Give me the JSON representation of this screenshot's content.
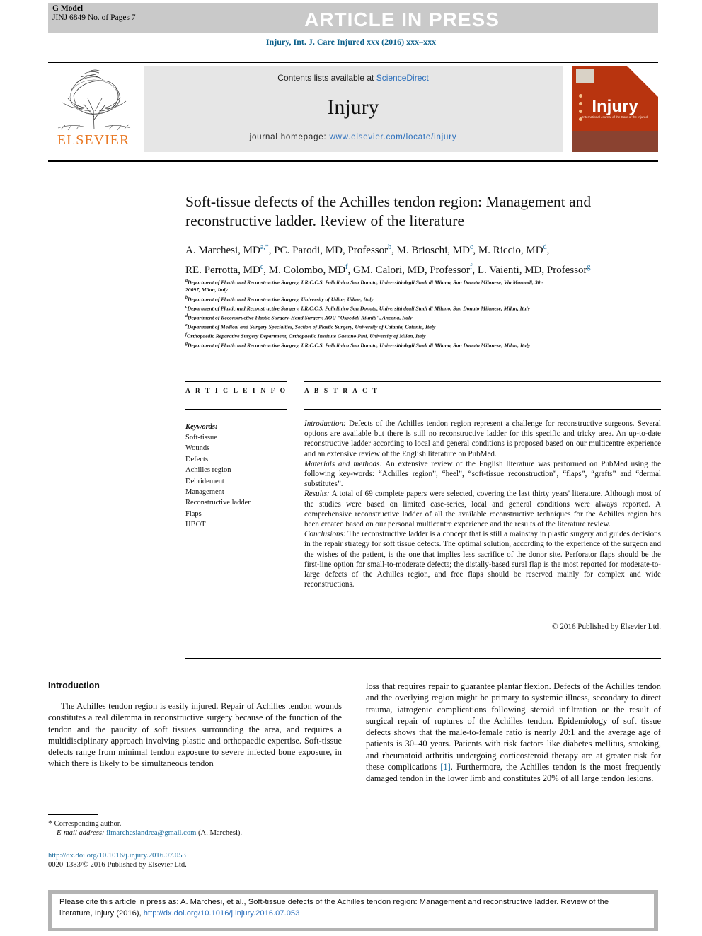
{
  "header": {
    "g_model_line1": "G Model",
    "g_model_line2": "JINJ 6849 No. of Pages 7",
    "article_in_press": "ARTICLE IN PRESS",
    "journal_ref": "Injury, Int. J. Care Injured xxx (2016) xxx–xxx"
  },
  "masthead": {
    "contents_prefix": "Contents lists available at ",
    "contents_link": "ScienceDirect",
    "journal_name": "Injury",
    "homepage_prefix": "journal homepage: ",
    "homepage_link": "www.elsevier.com/locate/injury",
    "publisher": "ELSEVIER",
    "cover_title": "Injury",
    "cover_sub": "International Journal of the Care of the Injured"
  },
  "article": {
    "title": "Soft-tissue defects of the Achilles tendon region: Management and reconstructive ladder. Review of the literature",
    "authors_line1": "A. Marchesi, MD",
    "authors_line2": "RE. Perrotta, MD",
    "authors_html_1": "A. Marchesi, MD<sup>a,*</sup>, PC. Parodi, MD, Professor<sup>b</sup>, M. Brioschi, MD<sup>c</sup>, M. Riccio, MD<sup>d</sup>,",
    "authors_html_2": "RE. Perrotta, MD<sup>e</sup>, M. Colombo, MD<sup>f</sup>, GM. Calori, MD, Professor<sup>f</sup>, L. Vaienti, MD, Professor<sup>g</sup>",
    "affiliations": [
      "a Department of Plastic and Reconstructive Surgery, I.R.C.C.S. Policlinico San Donato, Università degli Studi di Milano, San Donato Milanese, Via Morandi, 30 -",
      "20097, Milan, Italy",
      "b Department of Plastic and Reconstructive Surgery, University of Udine, Udine, Italy",
      "c Department of Plastic and Reconstructive Surgery, I.R.C.C.S. Policlinico San Donato, Università degli Studi di Milano, San Donato Milanese, Milan, Italy",
      "d Department of Reconstructive Plastic Surgery-Hand Surgery, AOU \"Ospedali Riuniti\", Ancona, Italy",
      "e Department of Medical and Surgery Specialties, Section of Plastic Surgery, University of Catania, Catania, Italy",
      "f Orthopaedic Reparative Surgery Department, Orthopaedic Institute Gaetano Pini, University of Milan, Italy",
      "g Department of Plastic and Reconstructive Surgery, I.R.C.C.S. Policlinico San Donato, Università degli Studi di Milano, San Donato Milanese, Milan, Italy"
    ]
  },
  "article_info": {
    "heading": "A R T I C L E  I N F O",
    "keywords_label": "Keywords:",
    "keywords": [
      "Soft-tissue",
      "Wounds",
      "Defects",
      "Achilles region",
      "Debridement",
      "Management",
      "Reconstructive ladder",
      "Flaps",
      "HBOT"
    ]
  },
  "abstract": {
    "heading": "A B S T R A C T",
    "introduction_label": "Introduction:",
    "introduction_text": " Defects of the Achilles tendon region represent a challenge for reconstructive surgeons. Several options are available but there is still no reconstructive ladder for this specific and tricky area. An up-to-date reconstructive ladder according to local and general conditions is proposed based on our multicentre experience and an extensive review of the English literature on PubMed.",
    "methods_label": "Materials and methods:",
    "methods_text": " An extensive review of the English literature was performed on PubMed using the following key-words: “Achilles region”, “heel”, “soft-tissue reconstruction”, “flaps”, “grafts” and “dermal substitutes”.",
    "results_label": "Results:",
    "results_text": " A total of 69 complete papers were selected, covering the last thirty years' literature. Although most of the studies were based on limited case-series, local and general conditions were always reported. A comprehensive reconstructive ladder of all the available reconstructive techniques for the Achilles region has been created based on our personal multicentre experience and the results of the literature review.",
    "conclusions_label": "Conclusions:",
    "conclusions_text": " The reconstructive ladder is a concept that is still a mainstay in plastic surgery and guides decisions in the repair strategy for soft tissue defects. The optimal solution, according to the experience of the surgeon and the wishes of the patient, is the one that implies less sacrifice of the donor site. Perforator flaps should be the first-line option for small-to-moderate defects; the distally-based sural flap is the most reported for moderate-to-large defects of the Achilles region, and free flaps should be reserved mainly for complex and wide reconstructions.",
    "copyright": "© 2016 Published by Elsevier Ltd."
  },
  "body": {
    "intro_heading": "Introduction",
    "left_paragraph": "The Achilles tendon region is easily injured. Repair of Achilles tendon wounds constitutes a real dilemma in reconstructive surgery because of the function of the tendon and the paucity of soft tissues surrounding the area, and requires a multidisciplinary approach involving plastic and orthopaedic expertise. Soft-tissue defects range from minimal tendon exposure to severe infected bone exposure, in which there is likely to be simultaneous tendon",
    "right_paragraph_part1": "loss that requires repair to guarantee plantar flexion. Defects of the Achilles tendon and the overlying region might be primary to systemic illness, secondary to direct trauma, iatrogenic complications following steroid infiltration or the result of surgical repair of ruptures of the Achilles tendon. Epidemiology of soft tissue defects shows that the male-to-female ratio is nearly 20:1 and the average age of patients is 30–40 years. Patients with risk factors like diabetes mellitus, smoking, and rheumatoid arthritis undergoing corticosteroid therapy are at greater risk for these complications ",
    "right_reference": "[1]",
    "right_paragraph_part2": ". Furthermore, the Achilles tendon is the most frequently damaged tendon in the lower limb and constitutes 20% of all large tendon lesions."
  },
  "footnotes": {
    "corresponding_author": "Corresponding author.",
    "email_label": "E-mail address:",
    "email": "ilmarchesiandrea@gmail.com",
    "email_owner": "(A. Marchesi).",
    "doi_url": "http://dx.doi.org/10.1016/j.injury.2016.07.053",
    "issn_line": "0020-1383/© 2016 Published by Elsevier Ltd."
  },
  "citation_footer": {
    "text_part1": "Please cite this article in press as: A. Marchesi, et al., Soft-tissue defects of the Achilles tendon region: Management and reconstructive ladder. Review of the literature, Injury (2016), ",
    "link": "http://dx.doi.org/10.1016/j.injury.2016.07.053"
  },
  "colors": {
    "link": "#2a6ebb",
    "journal_blue": "#0b5f8a",
    "elsevier_orange": "#e87722",
    "banner_grey": "#c9c9c9",
    "cover_red": "#b8340f"
  }
}
